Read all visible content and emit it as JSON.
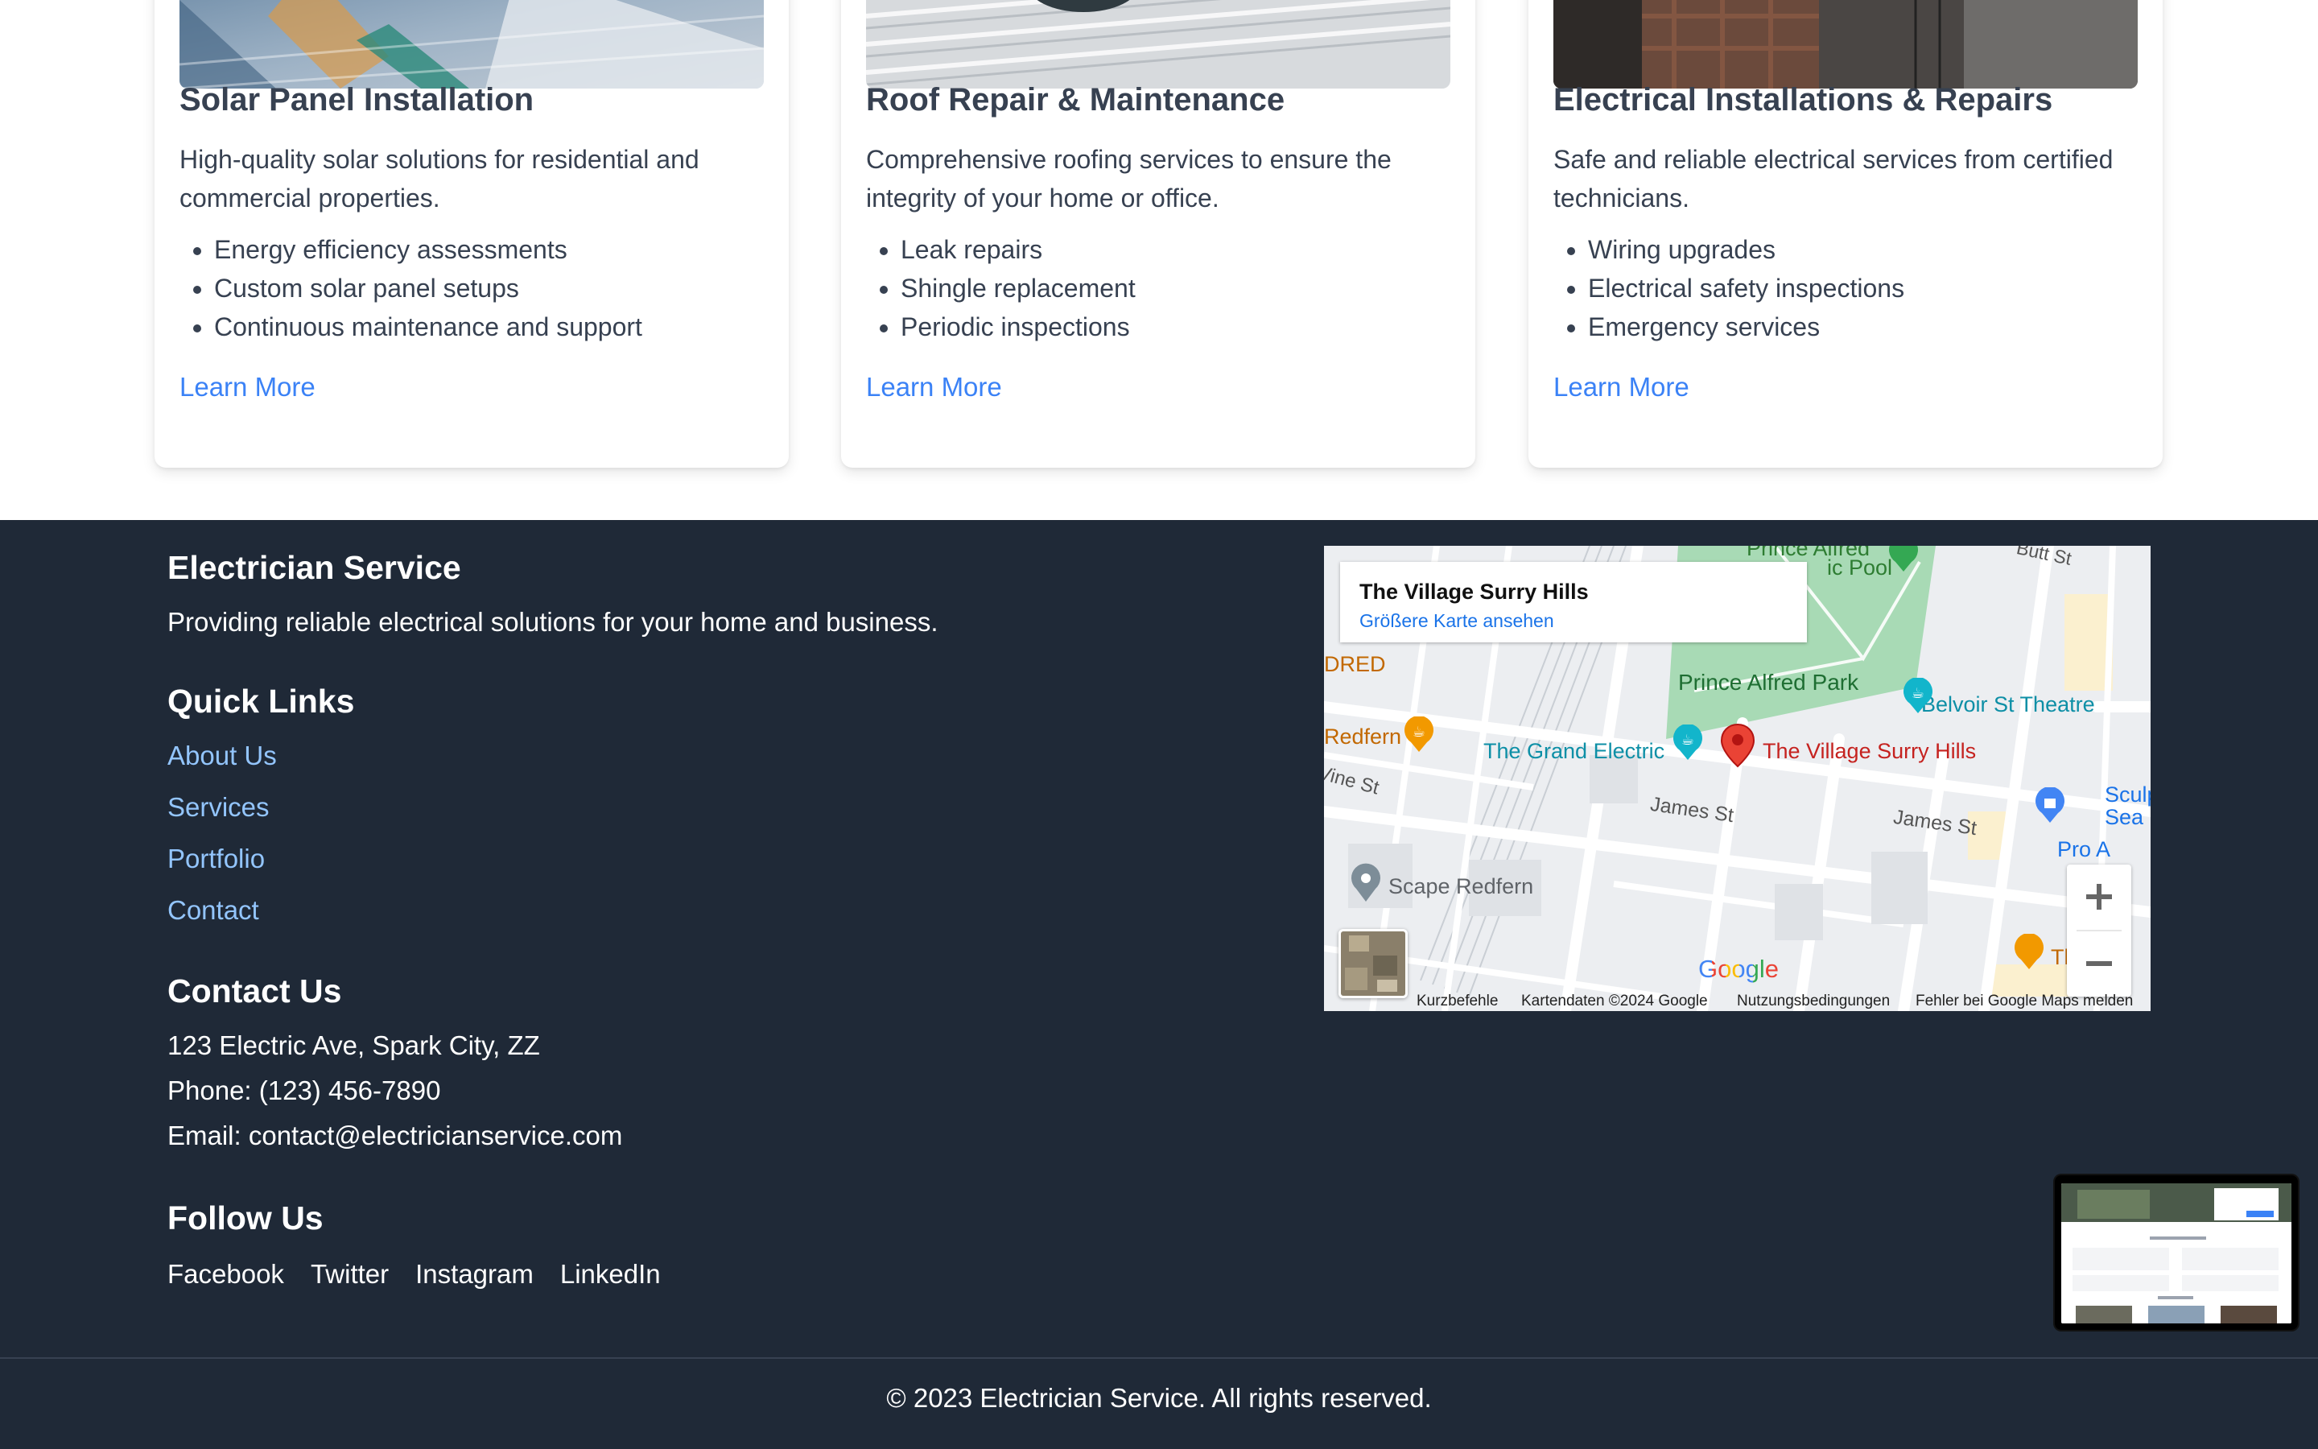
{
  "services": {
    "cards": [
      {
        "title": "Solar Panel Installation",
        "description": "High-quality solar solutions for residential and commercial properties.",
        "features": [
          "Energy efficiency assessments",
          "Custom solar panel setups",
          "Continuous maintenance and support"
        ],
        "link": "Learn More"
      },
      {
        "title": "Roof Repair & Maintenance",
        "description": "Comprehensive roofing services to ensure the integrity of your home or office.",
        "features": [
          "Leak repairs",
          "Shingle replacement",
          "Periodic inspections"
        ],
        "link": "Learn More"
      },
      {
        "title": "Electrical Installations & Repairs",
        "description": "Safe and reliable electrical services from certified technicians.",
        "features": [
          "Wiring upgrades",
          "Electrical safety inspections",
          "Emergency services"
        ],
        "link": "Learn More"
      }
    ]
  },
  "footer": {
    "brand": "Electrician Service",
    "tagline": "Providing reliable electrical solutions for your home and business.",
    "quick_links_title": "Quick Links",
    "quick_links": [
      "About Us",
      "Services",
      "Portfolio",
      "Contact"
    ],
    "contact_title": "Contact Us",
    "address": "123 Electric Ave, Spark City, ZZ",
    "phone": "Phone: (123) 456-7890",
    "email": "Email: contact@electricianservice.com",
    "follow_title": "Follow Us",
    "social": [
      "Facebook",
      "Twitter",
      "Instagram",
      "LinkedIn"
    ],
    "copyright": "© 2023 Electrician Service. All rights reserved."
  },
  "map": {
    "place_title": "The Village Surry Hills",
    "larger_map_link": "Größere Karte ansehen",
    "labels": {
      "pool": "Prince Alfred",
      "pool2": "ic Pool",
      "park": "Prince Alfred Park",
      "theatre": "Belvoir St Theatre",
      "grand_electric": "The Grand Electric",
      "village": "The Village Surry Hills",
      "redfern": "Redfern",
      "dred": "DRED",
      "james_st": "James St",
      "james_st2": "James St",
      "scape": "Scape Redfern",
      "sculpt": "Sculpt",
      "sea": "Sea Inc",
      "pro": "Pro A",
      "three": "Three",
      "butt_st": "Butt St",
      "vine_st": "Vine St"
    },
    "logo": "Google",
    "attribution": [
      "Kurzbefehle",
      "Kartendaten ©2024 Google",
      "Nutzungsbedingungen",
      "Fehler bei Google Maps melden"
    ],
    "zoom_in": "+",
    "zoom_out": "−"
  },
  "colors": {
    "footer_bg": "#1f2937",
    "link_blue": "#3b82f6",
    "footer_link": "#93c5fd",
    "map_pin": "#ea4335",
    "park_green": "#a8dab5"
  }
}
